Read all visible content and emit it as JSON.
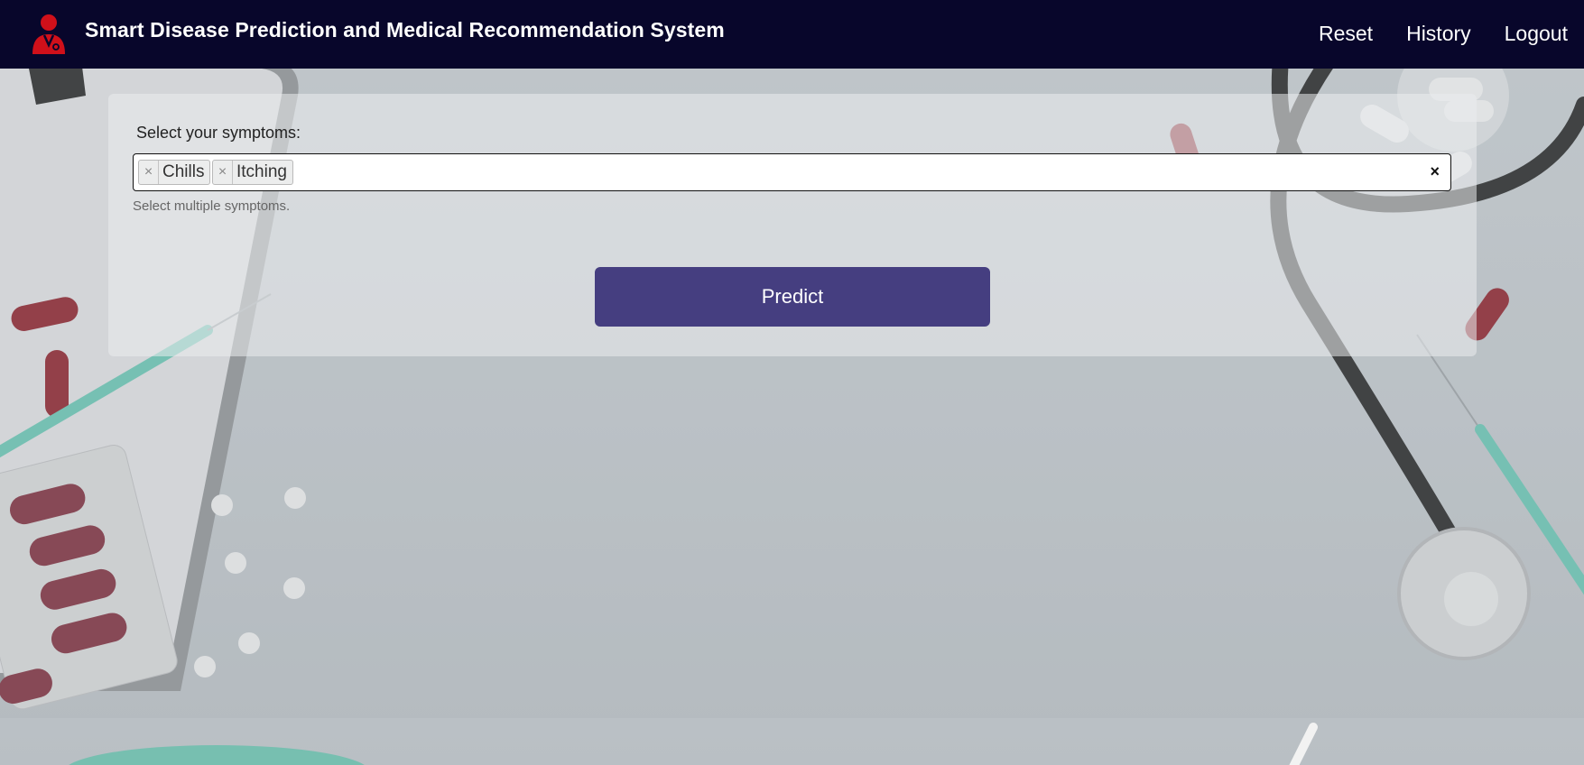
{
  "header": {
    "brand": "Smart Disease Prediction and Medical Recommendation System",
    "logo_icon": "doctor-icon",
    "nav": [
      {
        "label": "Reset"
      },
      {
        "label": "History"
      },
      {
        "label": "Logout"
      }
    ]
  },
  "form": {
    "label": "Select your symptoms:",
    "selected": [
      {
        "label": "Chills",
        "remove": "×"
      },
      {
        "label": "Itching",
        "remove": "×"
      }
    ],
    "clear_symbol": "×",
    "help": "Select multiple symptoms.",
    "submit_label": "Predict"
  },
  "colors": {
    "navbar": "#08062b",
    "button": "#453e80",
    "logo": "#d0101a"
  }
}
